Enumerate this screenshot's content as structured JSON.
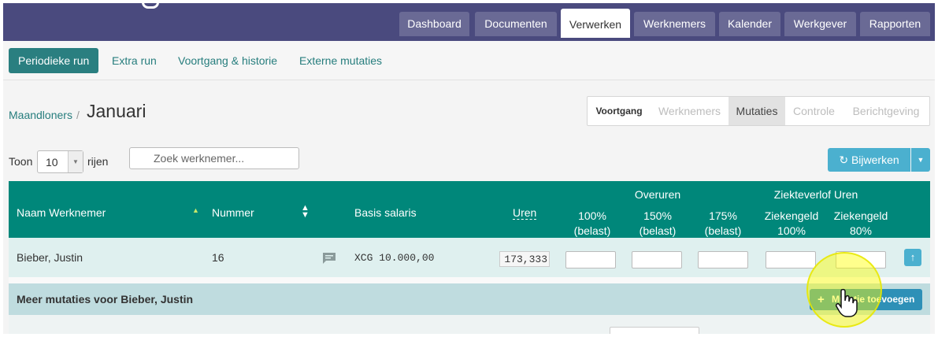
{
  "main_tabs": [
    {
      "label": "Dashboard"
    },
    {
      "label": "Documenten"
    },
    {
      "label": "Verwerken"
    },
    {
      "label": "Werknemers"
    },
    {
      "label": "Kalender"
    },
    {
      "label": "Werkgever"
    },
    {
      "label": "Rapporten"
    }
  ],
  "main_tabs_active": "Verwerken",
  "sub_nav": [
    {
      "label": "Periodieke run"
    },
    {
      "label": "Extra run"
    },
    {
      "label": "Voortgang & historie"
    },
    {
      "label": "Externe mutaties"
    }
  ],
  "breadcrumb": {
    "parent": "Maandloners",
    "separator": "/",
    "current": "Januari"
  },
  "steps": [
    {
      "label": "Voortgang"
    },
    {
      "label": "Werknemers"
    },
    {
      "label": "Mutaties"
    },
    {
      "label": "Controle"
    },
    {
      "label": "Berichtgeving"
    }
  ],
  "steps_active": "Mutaties",
  "toolbar": {
    "show_label": "Toon",
    "page_size": "10",
    "rows_label": "rijen",
    "search_placeholder": "Zoek werknemer...",
    "update_label": "Bijwerken"
  },
  "table": {
    "headers": {
      "name": "Naam Werknemer",
      "number": "Nummer",
      "base_salary": "Basis salaris",
      "hours": "Uren",
      "overtime_group": "Overuren",
      "overtime_100_a": "100%",
      "overtime_100_b": "(belast)",
      "overtime_150_a": "150%",
      "overtime_150_b": "(belast)",
      "overtime_175_a": "175%",
      "overtime_175_b": "(belast)",
      "sick_group": "Ziekteverlof Uren",
      "sick_100_a": "Ziekengeld",
      "sick_100_b": "100%",
      "sick_80_a": "Ziekengeld",
      "sick_80_b": "80%"
    },
    "rows": [
      {
        "name": "Bieber, Justin",
        "number": "16",
        "base_salary": "XCG 10.000,00",
        "hours": "173,333"
      }
    ]
  },
  "more_mutations": {
    "label": "Meer mutaties voor Bieber, Justin",
    "add_button": "Mutatie toevoegen"
  },
  "colors": {
    "topbar": "#4a4a7e",
    "tab_inactive": "#6a6a95",
    "accent_teal": "#00877a",
    "sub_active": "#2a7f80",
    "button_blue": "#4bb0cf",
    "highlight": "#ffff00"
  }
}
